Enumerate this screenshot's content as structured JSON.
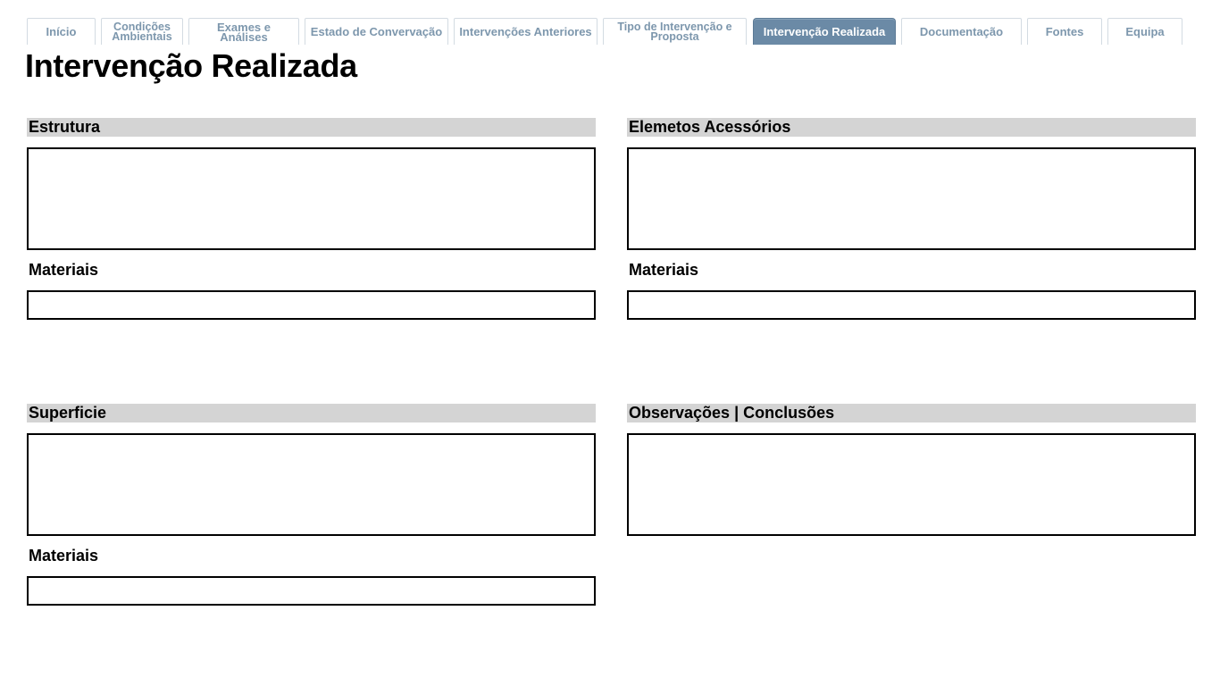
{
  "nav": {
    "tabs": [
      {
        "label": "Início",
        "active": false
      },
      {
        "label": "Condições Ambientais",
        "active": false
      },
      {
        "label": "Exames e Análises",
        "active": false
      },
      {
        "label": "Estado de Convervação",
        "active": false
      },
      {
        "label": "Intervenções Anteriores",
        "active": false
      },
      {
        "label": "Tipo de Intervenção e Proposta",
        "active": false
      },
      {
        "label": "Intervenção Realizada",
        "active": true
      },
      {
        "label": "Documentação",
        "active": false
      },
      {
        "label": "Fontes",
        "active": false
      },
      {
        "label": "Equipa",
        "active": false
      }
    ]
  },
  "page": {
    "title": "Intervenção Realizada"
  },
  "sections": {
    "estrutura": {
      "heading": "Estrutura",
      "value": "",
      "materials_label": "Materiais",
      "materials_value": ""
    },
    "elementos": {
      "heading": "Elemetos Acessórios",
      "value": "",
      "materials_label": "Materiais",
      "materials_value": ""
    },
    "superficie": {
      "heading": "Superficie",
      "value": "",
      "materials_label": "Materiais",
      "materials_value": ""
    },
    "observacoes": {
      "heading": "Observações | Conclusões",
      "value": ""
    }
  },
  "colors": {
    "tab_text": "#7d97ad",
    "tab_active_bg": "#6b8aa6",
    "section_bar_bg": "#d4d4d4"
  }
}
